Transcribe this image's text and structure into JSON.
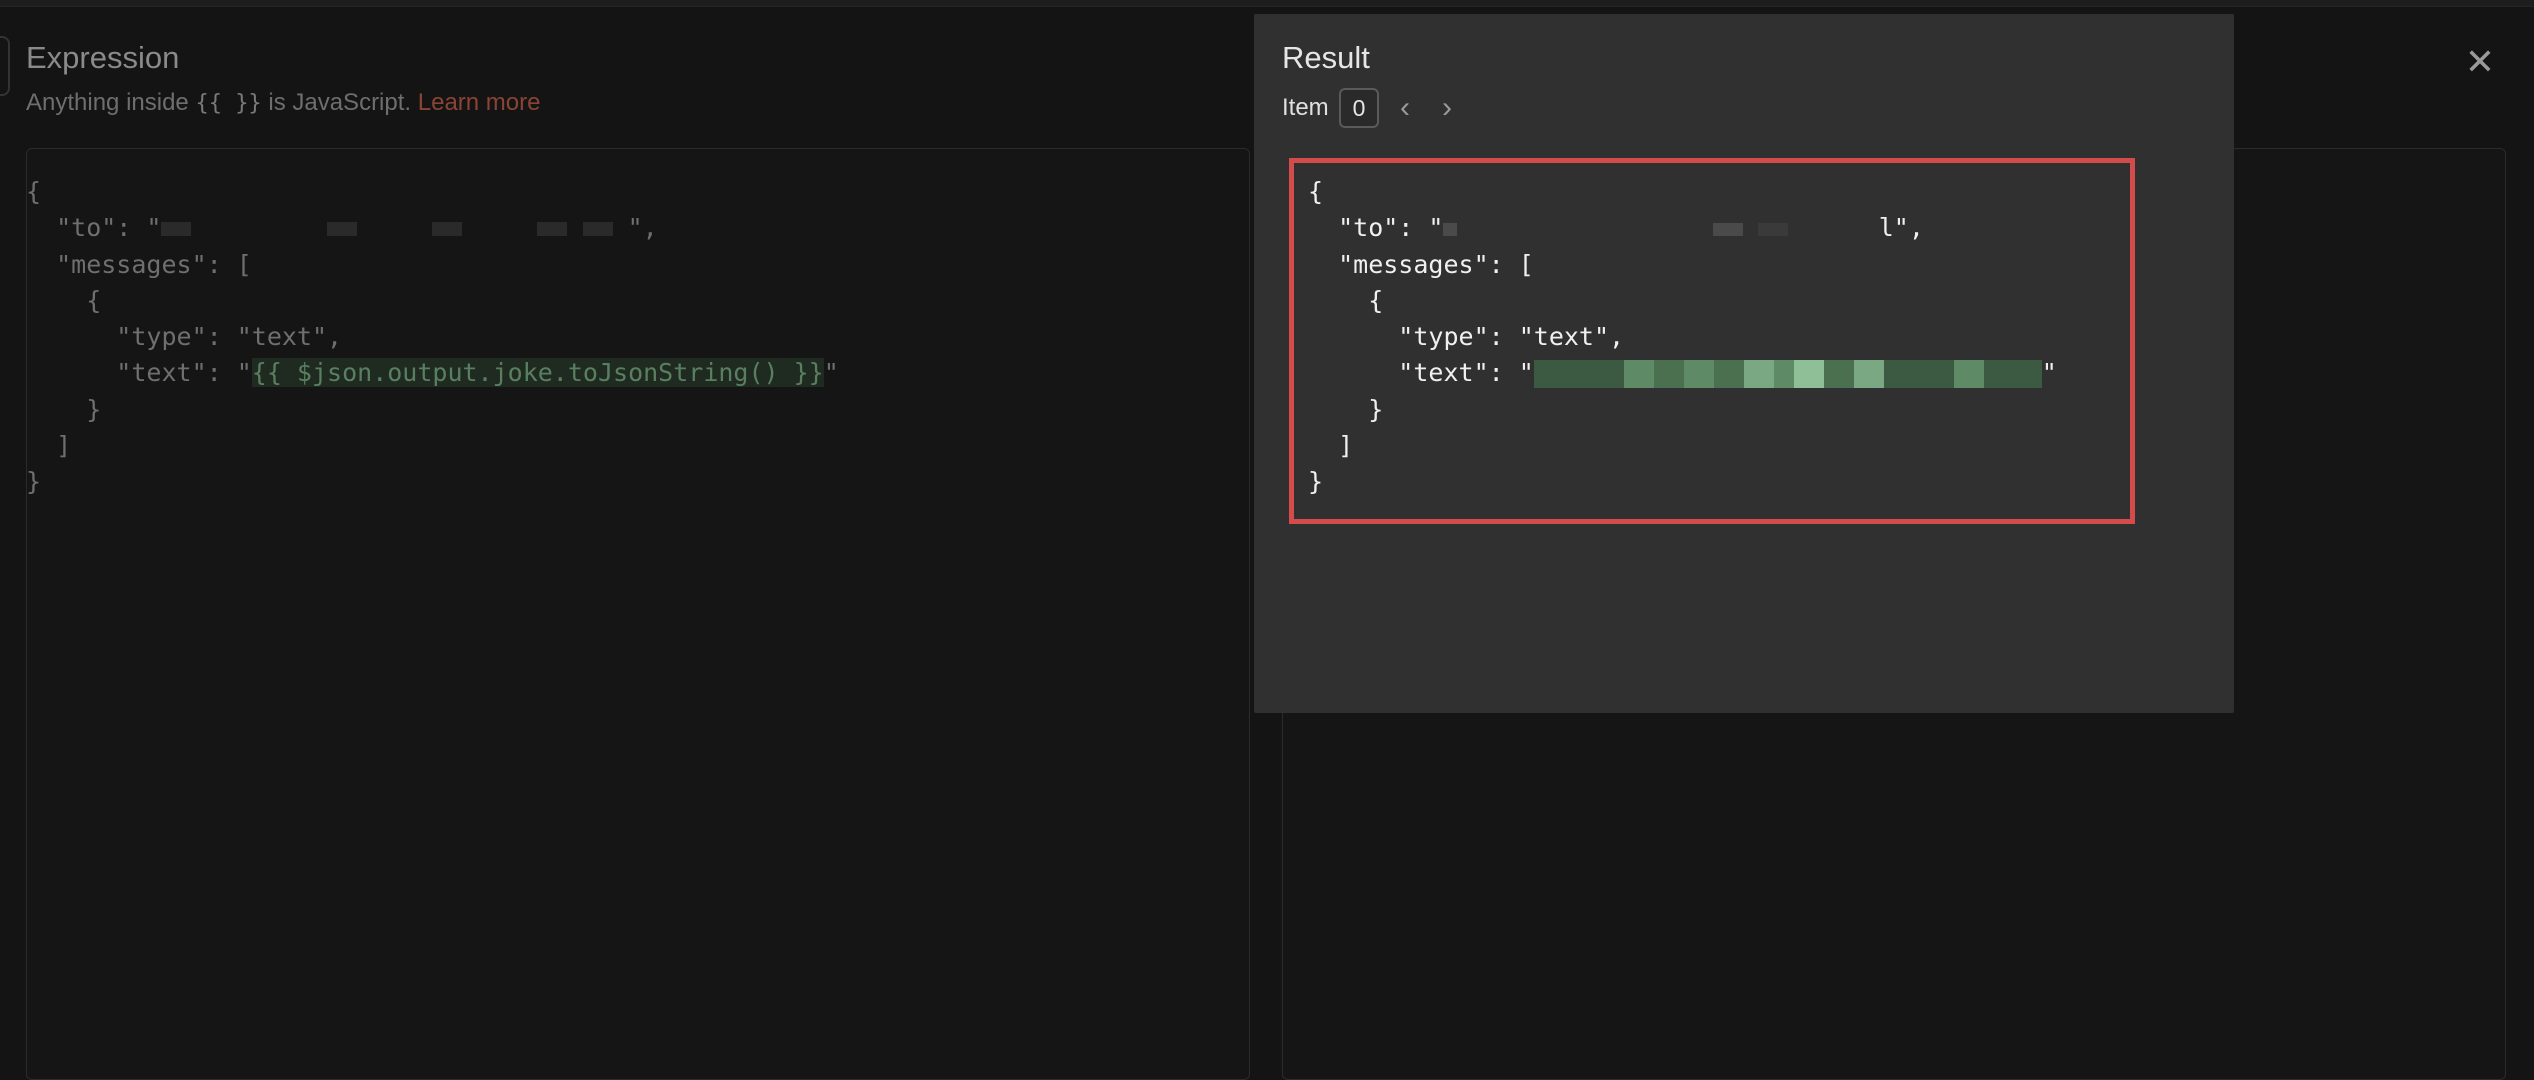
{
  "expression": {
    "title": "Expression",
    "subtitle_prefix": "Anything inside",
    "subtitle_braces": "{{ }}",
    "subtitle_suffix": "is JavaScript.",
    "learn_more": "Learn more",
    "code": {
      "open": "{",
      "to_key": "  \"to\": \"",
      "to_end": "\",",
      "messages": "  \"messages\": [",
      "obj_open": "    {",
      "type_line": "      \"type\": \"text\",",
      "text_key": "      \"text\": \"",
      "text_expr": "{{ $json.output.joke.toJsonString() }}",
      "text_end": "\"",
      "obj_close": "    }",
      "arr_close": "  ]",
      "close": "}"
    }
  },
  "result": {
    "title": "Result",
    "item_label": "Item",
    "item_value": "0",
    "prev_icon": "chevron-left-icon",
    "next_icon": "chevron-right-icon",
    "close_icon": "close-icon",
    "code": {
      "open": "{",
      "to_key": "  \"to\": \"",
      "to_end": "l\",",
      "messages": "  \"messages\": [",
      "obj_open": "    {",
      "type_line": "      \"type\": \"text\",",
      "text_key": "      \"text\": \"",
      "text_end": "\"",
      "obj_close": "    }",
      "arr_close": "  ]",
      "close": "}"
    }
  },
  "colors": {
    "background": "#141414",
    "overlay": "#303030",
    "highlight_border": "#d44b4b",
    "learn_more_link": "#8a4434"
  }
}
